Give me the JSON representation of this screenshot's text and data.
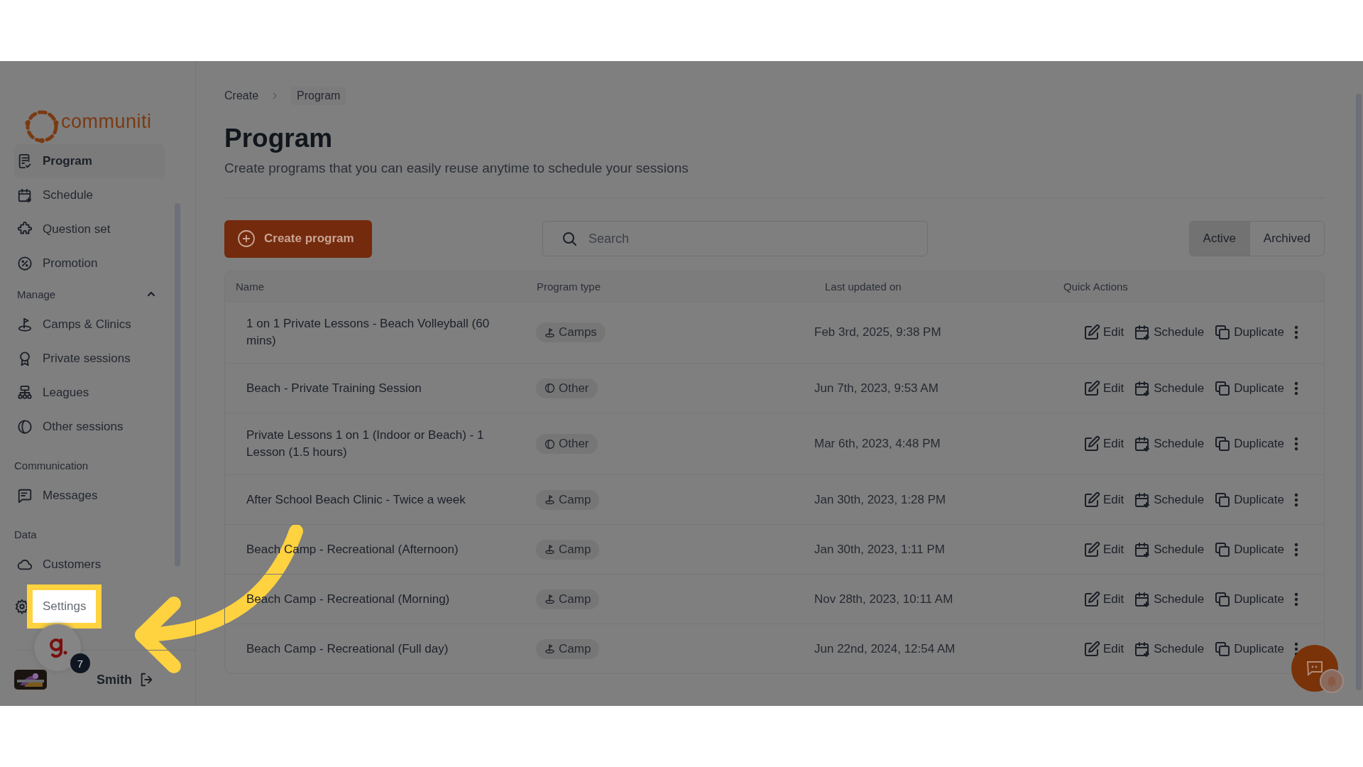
{
  "breadcrumb": [
    "Create",
    "Program"
  ],
  "sidebar": {
    "logo": "communiti",
    "sections": [
      {
        "items": [
          {
            "label": "Program",
            "selected": true
          },
          {
            "label": "Schedule",
            "selected": false
          },
          {
            "label": "Question set",
            "selected": false
          },
          {
            "label": "Promotion",
            "selected": false
          }
        ]
      },
      {
        "heading": "Manage",
        "expanded": true,
        "items": [
          {
            "label": "Camps & Clinics",
            "selected": false
          },
          {
            "label": "Private sessions",
            "selected": false
          },
          {
            "label": "Leagues",
            "selected": false
          },
          {
            "label": "Other sessions",
            "selected": false
          }
        ]
      },
      {
        "heading": "Communication",
        "items": [
          {
            "label": "Messages",
            "selected": false
          }
        ]
      },
      {
        "heading": "Data",
        "items": [
          {
            "label": "Customers",
            "selected": false
          }
        ]
      }
    ],
    "settings": {
      "label": "Settings",
      "highlighted": true
    },
    "user": {
      "name": "Smith"
    },
    "notification": {
      "badge": "7"
    }
  },
  "page": {
    "title": "Program",
    "subtitle": "Create programs that you can easily reuse anytime to schedule your sessions"
  },
  "toolbar": {
    "create_button": "Create program",
    "search": {
      "placeholder": "Search"
    },
    "tabs": [
      {
        "label": "Active",
        "selected": true
      },
      {
        "label": "Archived",
        "selected": false
      }
    ]
  },
  "table": {
    "columns": [
      "Name",
      "Program type",
      "Last updated on",
      "Quick Actions"
    ],
    "rows": [
      {
        "name": "1 on 1 Private Lessons - Beach Volleyball (60 mins)",
        "type": {
          "kind": "camp",
          "label": "Camps"
        },
        "updated": "Feb 3rd, 2025, 9:38 PM",
        "actions": [
          "Edit",
          "Schedule",
          "Duplicate"
        ]
      },
      {
        "name": "Beach - Private Training Session",
        "type": {
          "kind": "other",
          "label": "Other"
        },
        "updated": "Jun 7th, 2023, 9:53 AM",
        "actions": [
          "Edit",
          "Schedule",
          "Duplicate"
        ]
      },
      {
        "name": "Private Lessons 1 on 1 (Indoor or Beach) - 1 Lesson (1.5 hours)",
        "type": {
          "kind": "other",
          "label": "Other"
        },
        "updated": "Mar 6th, 2023, 4:48 PM",
        "actions": [
          "Edit",
          "Schedule",
          "Duplicate"
        ]
      },
      {
        "name": "After School Beach Clinic - Twice a week",
        "type": {
          "kind": "camp",
          "label": "Camp"
        },
        "updated": "Jan 30th, 2023, 1:28 PM",
        "actions": [
          "Edit",
          "Schedule",
          "Duplicate"
        ]
      },
      {
        "name": "Beach Camp - Recreational (Afternoon)",
        "type": {
          "kind": "camp",
          "label": "Camp"
        },
        "updated": "Jan 30th, 2023, 1:11 PM",
        "actions": [
          "Edit",
          "Schedule",
          "Duplicate"
        ]
      },
      {
        "name": "Beach Camp - Recreational (Morning)",
        "type": {
          "kind": "camp",
          "label": "Camp"
        },
        "updated": "Nov 28th, 2023, 10:11 AM",
        "actions": [
          "Edit",
          "Schedule",
          "Duplicate"
        ]
      },
      {
        "name": "Beach Camp - Recreational (Full day)",
        "type": {
          "kind": "camp",
          "label": "Camp"
        },
        "updated": "Jun 22nd, 2024, 12:54 AM",
        "actions": [
          "Edit",
          "Schedule",
          "Duplicate"
        ]
      }
    ]
  }
}
